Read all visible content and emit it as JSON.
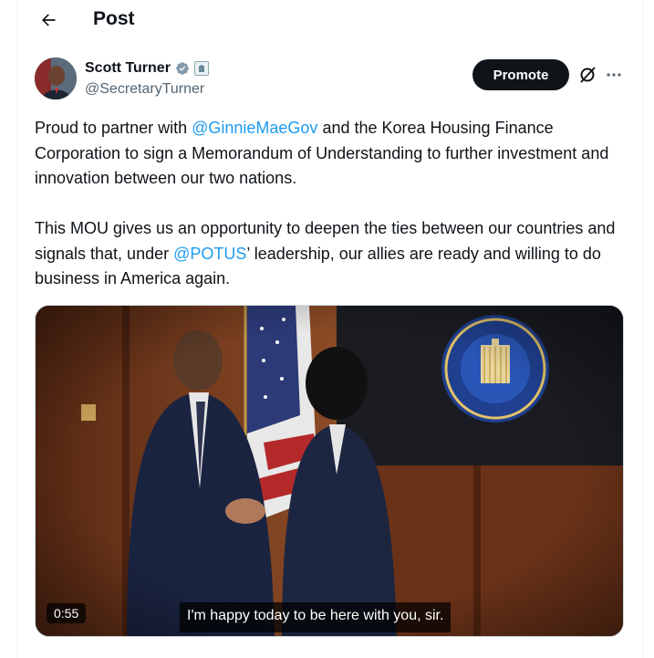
{
  "header": {
    "title": "Post"
  },
  "author": {
    "name": "Scott Turner",
    "handle": "@SecretaryTurner"
  },
  "actions": {
    "promote_label": "Promote"
  },
  "post": {
    "p1_a": "Proud to partner with ",
    "p1_mention": "@GinnieMaeGov",
    "p1_b": " and the Korea Housing Finance Corporation to sign a Memorandum of Understanding to further investment and innovation between our two nations.",
    "p2_a": "This MOU gives us an opportunity to deepen the ties between our countries and signals that, under ",
    "p2_mention": "@POTUS",
    "p2_b": "’ leadership, our allies are ready and willing to do business in America again."
  },
  "video": {
    "duration": "0:55",
    "caption": "I'm happy today to be here with you, sir."
  },
  "colors": {
    "link": "#1d9bf0",
    "verified": "#829aab",
    "promote_bg": "#0f1419"
  }
}
